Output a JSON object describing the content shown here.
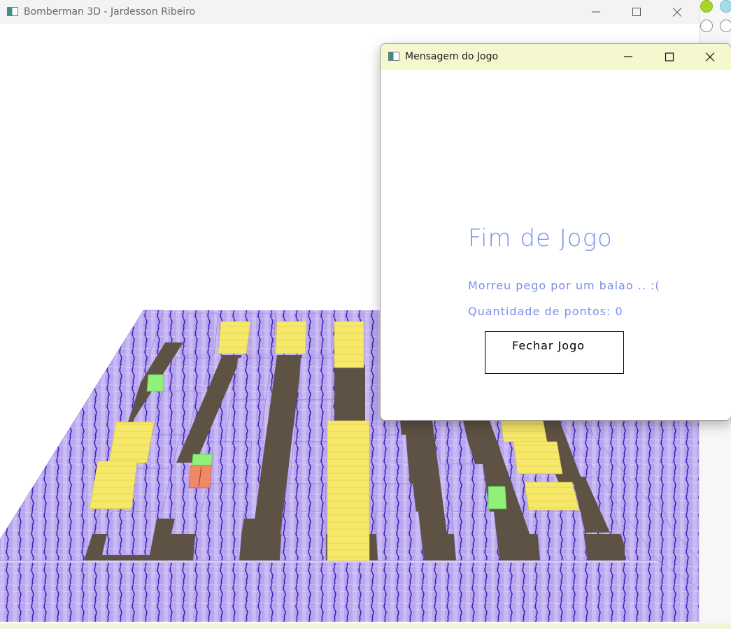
{
  "main_window": {
    "title": "Bomberman 3D - Jardesson Ribeiro",
    "icon": "app-window-icon",
    "controls": [
      "minimize-icon",
      "maximize-icon",
      "close-icon"
    ]
  },
  "dialog": {
    "title": "Mensagem do Jogo",
    "icon": "app-window-icon",
    "heading": "Fim de Jogo",
    "message": "Morreu pego por um balao .. :(",
    "score_text": "Quantidade de pontos: 0",
    "close_button_label": "Fechar Jogo",
    "controls": [
      "minimize-icon",
      "maximize-icon",
      "close-icon"
    ]
  },
  "colors": {
    "wall": "#b9a6ee",
    "wall_shadow": "#8c7bd6",
    "floor": "#5e5244",
    "crate_yellow": "#f6e86a",
    "balloon_green": "#8ff07a",
    "player_red": "#f08a66",
    "dialog_text": "#7a8ef0",
    "dialog_titlebar": "#f5f7cf"
  }
}
